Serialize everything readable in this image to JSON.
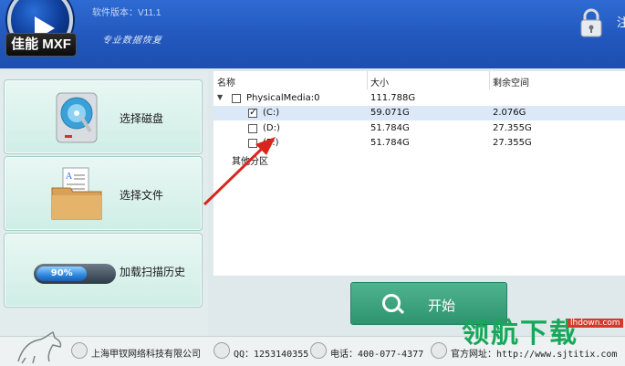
{
  "header": {
    "brand": "佳能 MXF",
    "version": "软件版本：V11.1",
    "slogan": "专业数据恢复",
    "right_char": "注"
  },
  "left_menu": [
    {
      "label": "选择磁盘",
      "icon": "disk-icon"
    },
    {
      "label": "选择文件",
      "icon": "folder-icon"
    },
    {
      "label": "加载扫描历史",
      "icon": "progress-icon",
      "progress": "90%"
    }
  ],
  "table": {
    "columns": [
      "名称",
      "大小",
      "剩余空间"
    ],
    "rows": [
      {
        "name": "PhysicalMedia:0",
        "size": "111.788G",
        "free": "",
        "checked": false,
        "level": 0
      },
      {
        "name": "(C:)",
        "size": "59.071G",
        "free": "2.076G",
        "checked": true,
        "level": 1
      },
      {
        "name": "(D:)",
        "size": "51.784G",
        "free": "27.355G",
        "checked": false,
        "level": 1
      },
      {
        "name": "(E:)",
        "size": "51.784G",
        "free": "27.355G",
        "checked": false,
        "level": 1
      }
    ],
    "other_partitions": "其他分区"
  },
  "start_button": {
    "label": "开始"
  },
  "footer": {
    "company": "上海甲钗网络科技有限公司",
    "qq": "QQ：1253140355",
    "phone": "电话：400-077-4377",
    "website": "官方网址：http://www.sjtitix.com"
  },
  "watermark": {
    "text": "领航下载",
    "site": "lhdown.com"
  },
  "colors": {
    "header": "#2257bd",
    "start": "#2e9470",
    "selected_row": "#dbe8f7"
  }
}
